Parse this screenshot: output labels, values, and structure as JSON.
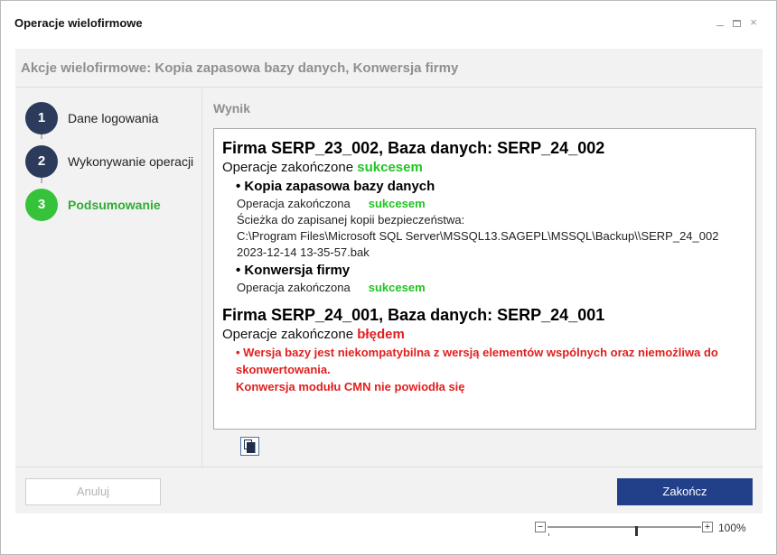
{
  "window": {
    "title": "Operacje wielofirmowe",
    "controls": {
      "minimize": "minimize-icon",
      "maximize": "maximize-icon",
      "close": "×"
    }
  },
  "header": {
    "heading": "Akcje wielofirmowe: Kopia zapasowa bazy danych, Konwersja firmy"
  },
  "steps": [
    {
      "number": "1",
      "label": "Dane logowania",
      "state": "done"
    },
    {
      "number": "2",
      "label": "Wykonywanie operacji",
      "state": "done"
    },
    {
      "number": "3",
      "label": "Podsumowanie",
      "state": "active"
    }
  ],
  "result": {
    "section_label": "Wynik",
    "companies": [
      {
        "title": "Firma SERP_23_002, Baza danych: SERP_24_002",
        "status_prefix": "Operacje zakończone ",
        "status_word": "sukcesem",
        "actions": [
          {
            "title": "• Kopia zapasowa bazy danych",
            "op_prefix": "Operacja zakończona",
            "op_status": "sukcesem",
            "path_label": "Ścieżka do zapisanej kopii bezpieczeństwa:",
            "path_line1": "C:\\Program Files\\Microsoft SQL Server\\MSSQL13.SAGEPL\\MSSQL\\Backup\\\\SERP_24_002",
            "path_line2": "2023-12-14 13-35-57.bak"
          },
          {
            "title": "• Konwersja firmy",
            "op_prefix": "Operacja zakończona",
            "op_status": "sukcesem"
          }
        ]
      },
      {
        "title": "Firma SERP_24_001, Baza danych: SERP_24_001",
        "status_prefix": "Operacje zakończone ",
        "status_word": "błędem",
        "error_line1": "• Wersja bazy jest niekompatybilna z wersją elementów wspólnych oraz niemożliwa do",
        "error_line2": "skonwertowania.",
        "error_line3": "Konwersja modułu CMN nie powiodła się"
      }
    ],
    "copy_icon": "copy-icon"
  },
  "footer": {
    "cancel_label": "Anuluj",
    "finish_label": "Zakończ"
  },
  "zoom": {
    "minus": "−",
    "plus": "+",
    "level": "100%"
  },
  "colors": {
    "step_done": "#2c3a5c",
    "step_active": "#36c23a",
    "success": "#21c424",
    "error": "#e01f1f",
    "primary_button": "#223f8a"
  }
}
